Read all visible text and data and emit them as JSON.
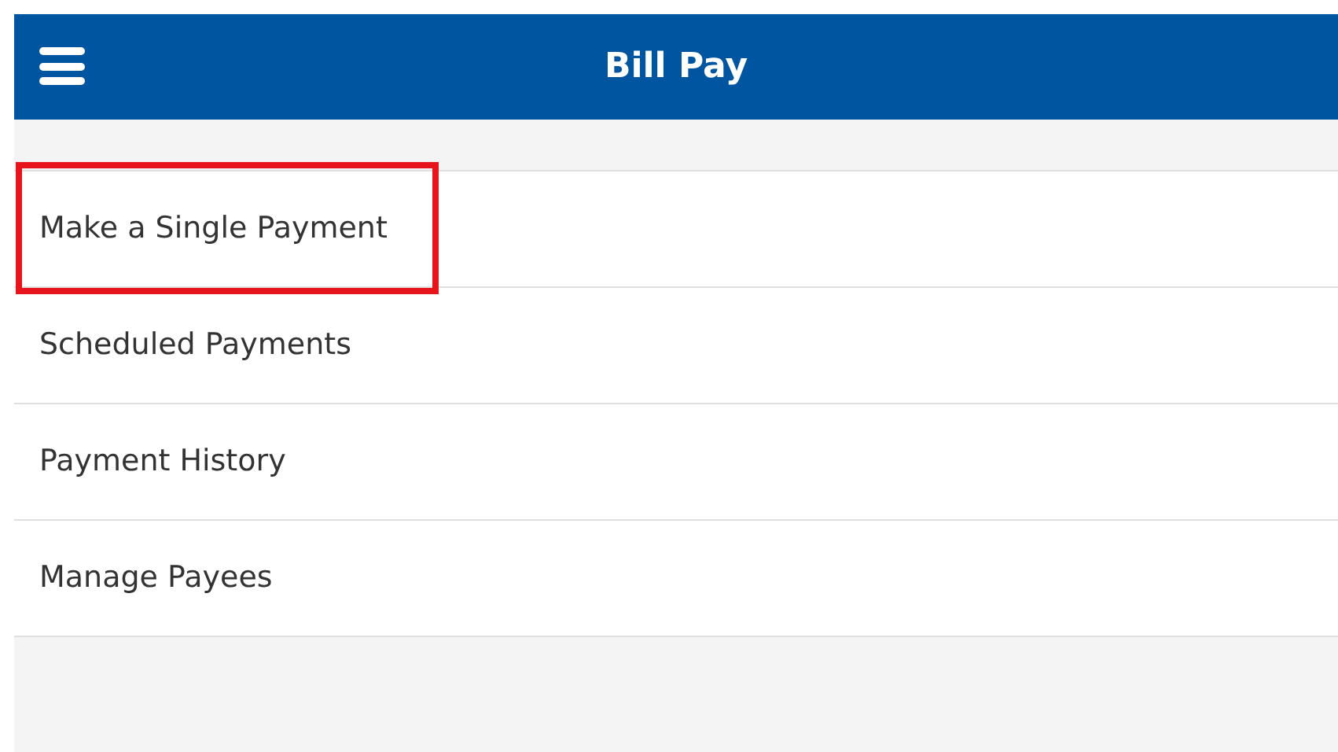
{
  "header": {
    "title": "Bill Pay"
  },
  "menu_items": [
    {
      "label": "Make a Single Payment",
      "highlighted": true
    },
    {
      "label": "Scheduled Payments",
      "highlighted": false
    },
    {
      "label": "Payment History",
      "highlighted": false
    },
    {
      "label": "Manage Payees",
      "highlighted": false
    }
  ]
}
